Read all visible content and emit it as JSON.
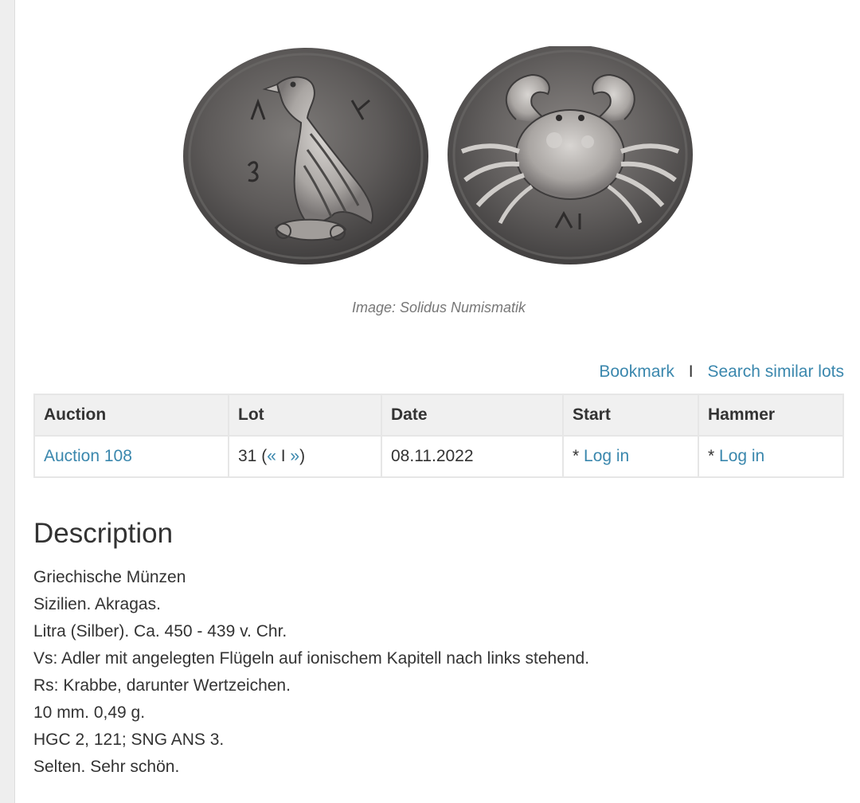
{
  "image": {
    "caption": "Image: Solidus Numismatik",
    "coins": [
      "eagle-obverse",
      "crab-reverse"
    ]
  },
  "actions": {
    "bookmark": "Bookmark",
    "separator": "I",
    "search_similar": "Search similar lots"
  },
  "table": {
    "headers": [
      "Auction",
      "Lot",
      "Date",
      "Start",
      "Hammer"
    ],
    "row": {
      "auction": "Auction 108",
      "lot_number": "31 (",
      "prev": "«",
      "lot_sep": "I",
      "next": "»",
      "lot_close": ")",
      "date": "08.11.2022",
      "start_prefix": "* ",
      "start_link": "Log in",
      "hammer_prefix": "* ",
      "hammer_link": "Log in"
    }
  },
  "description": {
    "title": "Description",
    "lines": [
      "Griechische Münzen",
      "Sizilien. Akragas.",
      "Litra (Silber). Ca. 450 - 439 v. Chr.",
      "Vs: Adler mit angelegten Flügeln auf ionischem Kapitell nach links stehend.",
      "Rs: Krabbe, darunter Wertzeichen.",
      "10 mm. 0,49 g.",
      "HGC 2, 121; SNG ANS 3.",
      "Selten. Sehr schön."
    ]
  },
  "colors": {
    "link": "#3a87ad",
    "header_bg": "#f0f0f0",
    "coin_dark": "#4a4848",
    "coin_light": "#8a8786"
  }
}
